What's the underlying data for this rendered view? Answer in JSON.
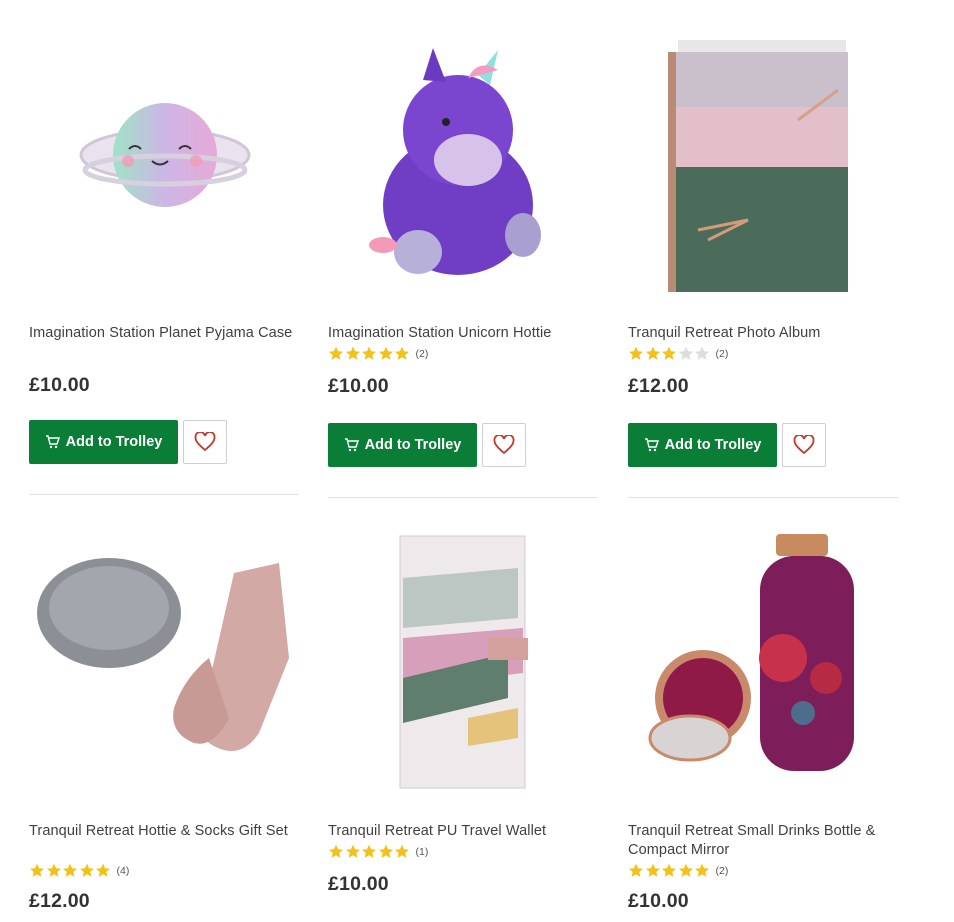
{
  "products": [
    {
      "title": "Imagination Station Planet Pyjama Case",
      "price": "£10.00",
      "rating": null,
      "review_count": "",
      "add_label": "Add to Trolley",
      "image": "planet-pyjama-case"
    },
    {
      "title": "Imagination Station Unicorn Hottie",
      "price": "£10.00",
      "rating": 5,
      "review_count": "(2)",
      "add_label": "Add to Trolley",
      "image": "unicorn-hottie"
    },
    {
      "title": "Tranquil Retreat Photo Album",
      "price": "£12.00",
      "rating": 3,
      "review_count": "(2)",
      "add_label": "Add to Trolley",
      "image": "photo-album"
    },
    {
      "title": "Tranquil Retreat Hottie & Socks Gift Set",
      "price": "£12.00",
      "rating": 5,
      "review_count": "(4)",
      "add_label": "",
      "image": "hottie-socks"
    },
    {
      "title": "Tranquil Retreat PU Travel Wallet",
      "price": "£10.00",
      "rating": 5,
      "review_count": "(1)",
      "add_label": "",
      "image": "travel-wallet"
    },
    {
      "title": "Tranquil Retreat Small Drinks Bottle & Compact Mirror",
      "price": "£10.00",
      "rating": 5,
      "review_count": "(2)",
      "add_label": "",
      "image": "bottle-mirror"
    }
  ],
  "colors": {
    "button_green": "#0a7d37",
    "star_filled": "#f2c21b",
    "star_empty": "#dddddd",
    "heart": "#c0392b"
  }
}
